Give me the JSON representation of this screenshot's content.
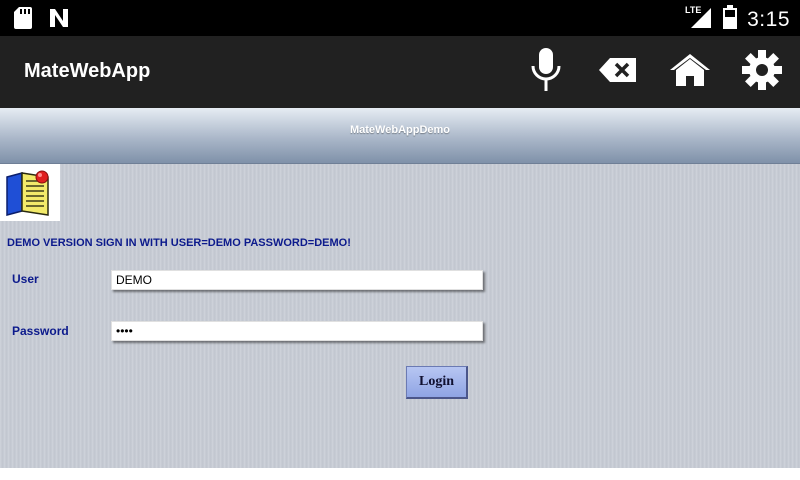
{
  "status_bar": {
    "time": "3:15",
    "network_label": "LTE",
    "icons": [
      "sd-card-icon",
      "n-notification-icon",
      "signal-icon",
      "battery-icon"
    ]
  },
  "app_bar": {
    "title": "MateWebApp",
    "actions": [
      {
        "name": "microphone",
        "icon": "microphone-icon"
      },
      {
        "name": "backspace",
        "icon": "backspace-icon"
      },
      {
        "name": "home",
        "icon": "home-icon"
      },
      {
        "name": "settings",
        "icon": "gear-icon"
      }
    ]
  },
  "web_page": {
    "header_title": "MateWebAppDemo",
    "notice": "DEMO VERSION SIGN IN WITH USER=DEMO PASSWORD=DEMO!",
    "form": {
      "user_label": "User",
      "user_value": "DEMO",
      "password_label": "Password",
      "password_value": "DEMO",
      "login_label": "Login"
    }
  },
  "colors": {
    "status_bar_bg": "#000000",
    "app_bar_bg": "#212121",
    "page_bg": "#c7ccd5",
    "label_text": "#0c1a8c",
    "login_button": "#9fb2ec"
  }
}
